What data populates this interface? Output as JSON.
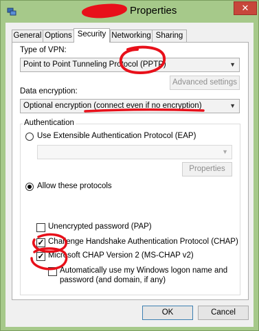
{
  "window": {
    "title": "Properties",
    "close_glyph": "✕"
  },
  "tabs": [
    {
      "label": "General"
    },
    {
      "label": "Options"
    },
    {
      "label": "Security"
    },
    {
      "label": "Networking"
    },
    {
      "label": "Sharing"
    }
  ],
  "security": {
    "vpn_type_label": "Type of VPN:",
    "vpn_type_value": "Point to Point Tunneling Protocol (PPTP)",
    "advanced_settings": "Advanced settings",
    "encryption_label": "Data encryption:",
    "encryption_value": "Optional encryption (connect even if no encryption)",
    "auth_group": "Authentication",
    "eap_label": "Use Extensible Authentication Protocol (EAP)",
    "eap_value": "",
    "properties_button": "Properties",
    "allow_label": "Allow these protocols",
    "protocols": [
      {
        "label": "Unencrypted password (PAP)",
        "checked": false
      },
      {
        "label": "Challenge Handshake Authentication Protocol (CHAP)",
        "checked": true
      },
      {
        "label": "Microsoft CHAP Version 2 (MS-CHAP v2)",
        "checked": true
      }
    ],
    "auto_logon_line1": "Automatically use my Windows logon name and",
    "auto_logon_line2": "password (and domain, if any)",
    "auto_logon_checked": false
  },
  "footer": {
    "ok": "OK",
    "cancel": "Cancel"
  },
  "colors": {
    "annotation": "#e8101a",
    "title_bar": "#a6c98a",
    "close": "#c7463b"
  }
}
